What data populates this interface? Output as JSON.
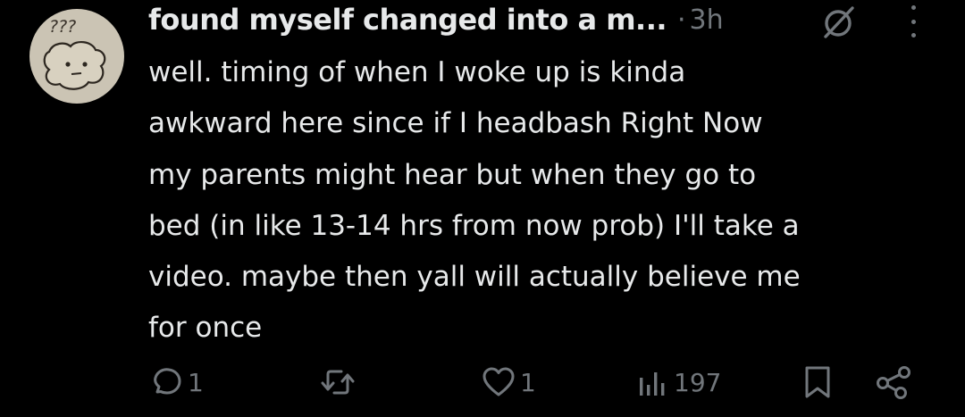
{
  "post": {
    "display_name": "found myself changed into a m...",
    "separator": "·",
    "timestamp": "3h",
    "body": "well. timing of when I woke up is kinda\nawkward here since if I headbash Right Now\nmy parents might hear but when they go to\nbed (in like 13-14 hrs from now prob) I'll take a\nvideo. maybe then yall will actually believe me\nfor once",
    "avatar_scribble": "???"
  },
  "actions": {
    "reply_count": "1",
    "repost_count": "",
    "like_count": "1",
    "view_count": "197"
  },
  "icons": {
    "reply": "reply-icon",
    "repost": "repost-icon",
    "like": "heart-icon",
    "views": "views-icon",
    "bookmark": "bookmark-icon",
    "share": "share-icon",
    "grok": "grok-icon",
    "more": "more-icon"
  },
  "colors": {
    "background": "#000000",
    "text": "#e7e9ea",
    "muted": "#71767b",
    "avatar_bg": "#cbc4b4"
  }
}
